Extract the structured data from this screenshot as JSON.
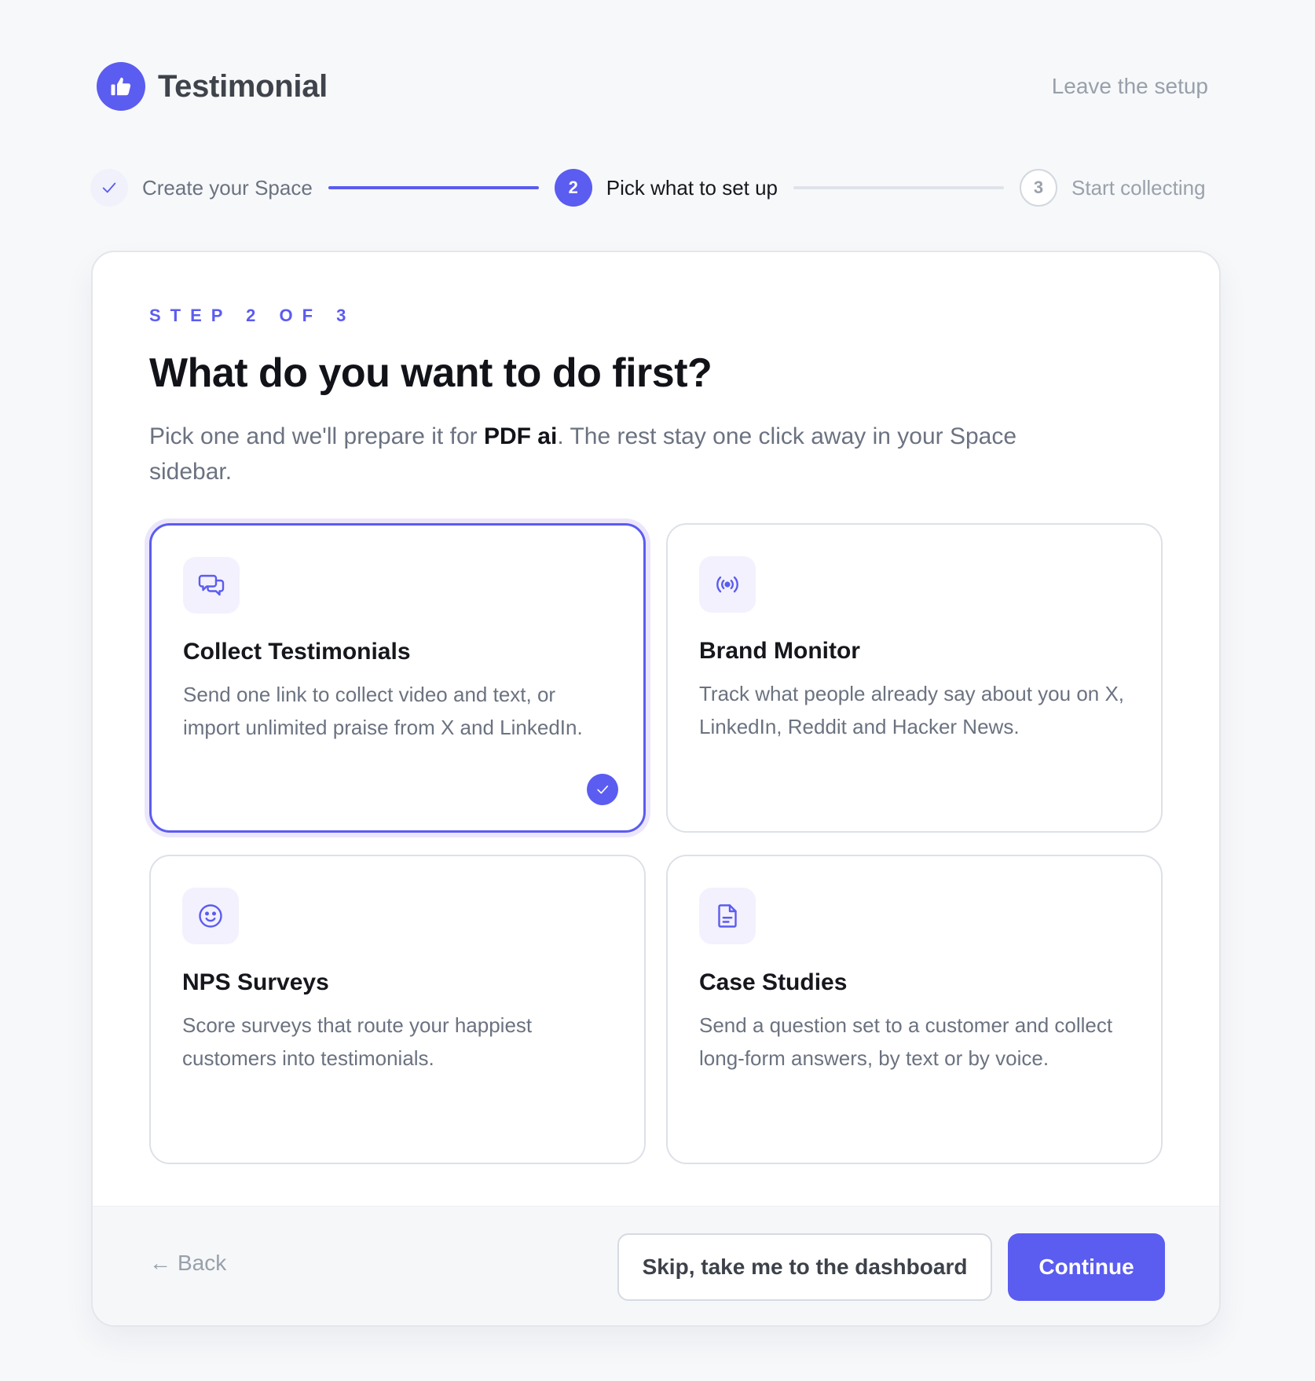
{
  "header": {
    "brand_name": "Testimonial",
    "logo_icon": "thumbs-up-icon",
    "leave_label": "Leave the setup"
  },
  "stepper": {
    "steps": [
      {
        "label": "Create your Space",
        "status": "done",
        "marker": "✓"
      },
      {
        "label": "Pick what to set up",
        "status": "active",
        "marker": "2"
      },
      {
        "label": "Start collecting",
        "status": "todo",
        "marker": "3"
      }
    ]
  },
  "main": {
    "eyebrow": "STEP 2 OF 3",
    "title": "What do you want to do first?",
    "subtitle_pre": "Pick one and we'll prepare it for ",
    "subtitle_bold": "PDF ai",
    "subtitle_post": ". The rest stay one click away in your Space sidebar."
  },
  "options": [
    {
      "title": "Collect Testimonials",
      "desc": "Send one link to collect video and text, or import unlimited praise from X and LinkedIn.",
      "icon": "chat-bubbles-icon",
      "selected": true
    },
    {
      "title": "Brand Monitor",
      "desc": "Track what people already say about you on X, LinkedIn, Reddit and Hacker News.",
      "icon": "broadcast-icon",
      "selected": false
    },
    {
      "title": "NPS Surveys",
      "desc": "Score surveys that route your happiest customers into testimonials.",
      "icon": "smiley-icon",
      "selected": false
    },
    {
      "title": "Case Studies",
      "desc": "Send a question set to a customer and collect long-form answers, by text or by voice.",
      "icon": "document-icon",
      "selected": false
    }
  ],
  "footer": {
    "back_label": "Back",
    "back_arrow": "←",
    "skip_label": "Skip, take me to the dashboard",
    "continue_label": "Continue"
  },
  "colors": {
    "accent": "#5b5cf0",
    "muted_text": "#6b7280",
    "background": "#f7f8fa"
  }
}
